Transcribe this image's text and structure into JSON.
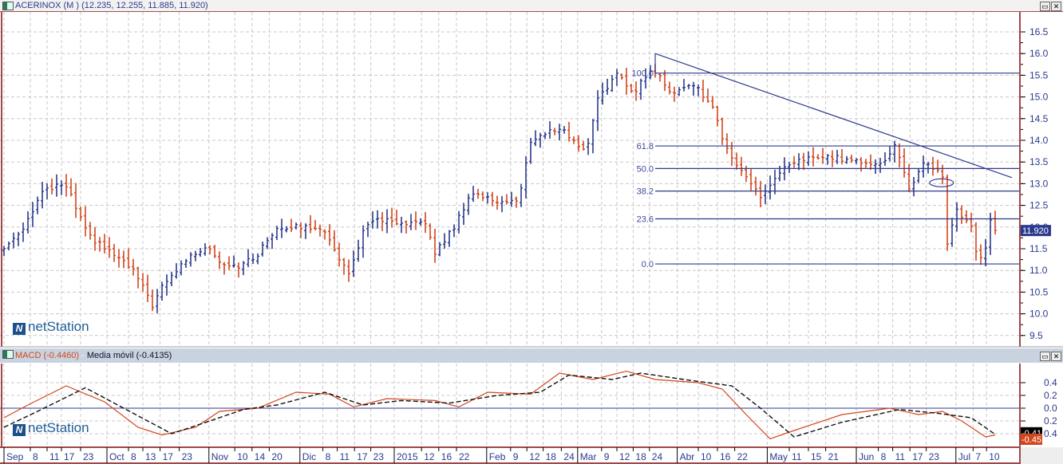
{
  "window": {
    "title": "ACERINOX (M ) (12.235, 12.255, 11.885, 11.920)",
    "macd_label": "MACD (-0.4460)",
    "macd_sep": " - ",
    "signal_label": "Media móvil (-0.4135)",
    "logo_text": "netStation",
    "restore_icon": "restore-icon",
    "close_icon": "close-icon",
    "restore_glyph": "▭",
    "close_glyph": "✕"
  },
  "colors": {
    "up": "#2b3a8c",
    "down": "#d2461e",
    "frame": "#a04848",
    "fib": "#2b3a8c",
    "last_bg": "#2b3a8c"
  },
  "chart_data": [
    {
      "type": "ohlc",
      "title": "ACERINOX (M )",
      "ylim": [
        9.5,
        16.5
      ],
      "y_ticks": [
        "9.5",
        "10.0",
        "10.5",
        "11.0",
        "11.5",
        "12.0",
        "12.5",
        "13.0",
        "13.5",
        "14.0",
        "14.5",
        "15.0",
        "15.5",
        "16.0",
        "16.5"
      ],
      "last_price": "11.920",
      "bar_count": 208,
      "close_keypoints": [
        [
          0,
          11.5
        ],
        [
          4,
          12.0
        ],
        [
          8,
          12.8
        ],
        [
          12.5,
          13.0
        ],
        [
          14,
          12.7
        ],
        [
          17.5,
          11.8
        ],
        [
          22.5,
          11.4
        ],
        [
          27,
          11.0
        ],
        [
          31,
          10.2
        ],
        [
          33,
          10.6
        ],
        [
          37.5,
          11.2
        ],
        [
          42.5,
          11.6
        ],
        [
          45,
          11.2
        ],
        [
          49,
          11.1
        ],
        [
          52.5,
          11.3
        ],
        [
          57,
          12.0
        ],
        [
          66,
          12.0
        ],
        [
          69,
          11.5
        ],
        [
          72,
          10.9
        ],
        [
          75,
          11.9
        ],
        [
          78,
          12.2
        ],
        [
          84,
          12.0
        ],
        [
          87.5,
          12.2
        ],
        [
          90,
          11.4
        ],
        [
          94,
          12.0
        ],
        [
          97.5,
          12.8
        ],
        [
          102.5,
          12.6
        ],
        [
          107.5,
          12.6
        ],
        [
          110,
          14.0
        ],
        [
          116,
          14.3
        ],
        [
          119,
          14.0
        ],
        [
          121.5,
          13.7
        ],
        [
          124,
          15.0
        ],
        [
          128,
          15.5
        ],
        [
          131.5,
          15.1
        ],
        [
          134,
          15.5
        ],
        [
          136,
          15.6
        ],
        [
          139,
          15.1
        ],
        [
          144,
          15.3
        ],
        [
          148,
          14.8
        ],
        [
          150,
          14.0
        ],
        [
          154,
          13.3
        ],
        [
          158,
          12.7
        ],
        [
          162.5,
          13.3
        ],
        [
          167.5,
          13.6
        ],
        [
          174,
          13.6
        ],
        [
          179,
          13.5
        ],
        [
          184,
          13.5
        ],
        [
          186,
          13.9
        ],
        [
          189,
          12.9
        ],
        [
          192.5,
          13.5
        ],
        [
          196,
          13.2
        ],
        [
          197,
          11.6
        ],
        [
          199,
          12.4
        ],
        [
          202,
          12.0
        ],
        [
          203.5,
          11.2
        ],
        [
          205,
          11.5
        ],
        [
          206,
          12.2
        ],
        [
          207,
          11.92
        ]
      ],
      "fibonacci": {
        "start_bar": 136,
        "levels": [
          {
            "label": "100.0",
            "price": 15.55
          },
          {
            "label": "61.8",
            "price": 13.87
          },
          {
            "label": "50.0",
            "price": 13.35
          },
          {
            "label": "38.2",
            "price": 12.83
          },
          {
            "label": "23.6",
            "price": 12.19
          },
          {
            "label": "0.0",
            "price": 11.15
          }
        ]
      },
      "trendline": [
        [
          136,
          16.0
        ],
        [
          210.5,
          13.14
        ]
      ],
      "ellipse": {
        "bar": 195.8,
        "price": 13.02
      }
    },
    {
      "type": "line",
      "title": "MACD",
      "ylim": [
        -0.6,
        0.6
      ],
      "y_ticks": [
        {
          "v": 0.4,
          "t": "0.4"
        },
        {
          "v": 0.2,
          "t": "0.2"
        },
        {
          "v": 0.0,
          "t": "0.0"
        },
        {
          "v": -0.2,
          "t": "0.2"
        },
        {
          "v": -0.4,
          "t": "0.4"
        }
      ],
      "series": [
        {
          "name": "MACD",
          "last": "-0.45",
          "style": "solid",
          "points": [
            [
              0,
              -0.15
            ],
            [
              5,
              0.05
            ],
            [
              13,
              0.35
            ],
            [
              21,
              0.1
            ],
            [
              28,
              -0.3
            ],
            [
              33,
              -0.42
            ],
            [
              40,
              -0.3
            ],
            [
              45,
              -0.05
            ],
            [
              53,
              0.0
            ],
            [
              61,
              0.25
            ],
            [
              68,
              0.22
            ],
            [
              73,
              0.02
            ],
            [
              80,
              0.15
            ],
            [
              90,
              0.12
            ],
            [
              95,
              0.02
            ],
            [
              101,
              0.25
            ],
            [
              110,
              0.22
            ],
            [
              116,
              0.55
            ],
            [
              123,
              0.45
            ],
            [
              130,
              0.58
            ],
            [
              136,
              0.45
            ],
            [
              145,
              0.4
            ],
            [
              150,
              0.3
            ],
            [
              155,
              -0.1
            ],
            [
              160,
              -0.48
            ],
            [
              165,
              -0.35
            ],
            [
              175,
              -0.1
            ],
            [
              185,
              0.0
            ],
            [
              191,
              -0.1
            ],
            [
              196,
              -0.05
            ],
            [
              200,
              -0.2
            ],
            [
              205,
              -0.45
            ],
            [
              207,
              -0.42
            ]
          ]
        },
        {
          "name": "Media móvil",
          "last": "-0.41",
          "style": "dashed",
          "points": [
            [
              0,
              -0.3
            ],
            [
              7,
              -0.05
            ],
            [
              17,
              0.32
            ],
            [
              25,
              0.0
            ],
            [
              35,
              -0.4
            ],
            [
              43,
              -0.2
            ],
            [
              50,
              -0.02
            ],
            [
              57,
              0.05
            ],
            [
              67,
              0.25
            ],
            [
              75,
              0.05
            ],
            [
              83,
              0.12
            ],
            [
              93,
              0.08
            ],
            [
              103,
              0.2
            ],
            [
              112,
              0.25
            ],
            [
              118,
              0.52
            ],
            [
              127,
              0.45
            ],
            [
              133,
              0.55
            ],
            [
              142,
              0.45
            ],
            [
              152,
              0.35
            ],
            [
              158,
              0.0
            ],
            [
              165,
              -0.45
            ],
            [
              175,
              -0.22
            ],
            [
              187,
              -0.02
            ],
            [
              195,
              -0.08
            ],
            [
              202,
              -0.15
            ],
            [
              207,
              -0.41
            ]
          ]
        }
      ]
    }
  ],
  "x_axis": {
    "labels": [
      {
        "t": "Sep",
        "bar": 0,
        "month": true
      },
      {
        "t": "8",
        "bar": 5.5
      },
      {
        "t": "11",
        "bar": 9
      },
      {
        "t": "17",
        "bar": 12
      },
      {
        "t": "23",
        "bar": 16
      },
      {
        "t": "Oct",
        "bar": 21.5,
        "month": true
      },
      {
        "t": "8",
        "bar": 26
      },
      {
        "t": "13",
        "bar": 29
      },
      {
        "t": "17",
        "bar": 32.6
      },
      {
        "t": "23",
        "bar": 36.6
      },
      {
        "t": "Nov",
        "bar": 42.8,
        "month": true
      },
      {
        "t": "10",
        "bar": 48.2
      },
      {
        "t": "14",
        "bar": 51.8
      },
      {
        "t": "20",
        "bar": 55.4
      },
      {
        "t": "Dic",
        "bar": 61.8,
        "month": true
      },
      {
        "t": "8",
        "bar": 66.6
      },
      {
        "t": "11",
        "bar": 69.6
      },
      {
        "t": "17",
        "bar": 73.2
      },
      {
        "t": "23",
        "bar": 76.6
      },
      {
        "t": "2015",
        "bar": 81.5,
        "month": true
      },
      {
        "t": "12",
        "bar": 87.2
      },
      {
        "t": "16",
        "bar": 90.8
      },
      {
        "t": "22",
        "bar": 94.5
      },
      {
        "t": "Feb",
        "bar": 100.8,
        "month": true
      },
      {
        "t": "9",
        "bar": 105.8
      },
      {
        "t": "12",
        "bar": 109.2
      },
      {
        "t": "18",
        "bar": 112.6
      },
      {
        "t": "24",
        "bar": 116.4
      },
      {
        "t": "Mar",
        "bar": 119.8,
        "month": true
      },
      {
        "t": "9",
        "bar": 124.8
      },
      {
        "t": "12",
        "bar": 128
      },
      {
        "t": "18",
        "bar": 131.4
      },
      {
        "t": "24",
        "bar": 134.8
      },
      {
        "t": "Abr",
        "bar": 140.6,
        "month": true
      },
      {
        "t": "10",
        "bar": 145
      },
      {
        "t": "16",
        "bar": 149
      },
      {
        "t": "22",
        "bar": 152.6
      },
      {
        "t": "May",
        "bar": 159.4,
        "month": true
      },
      {
        "t": "11",
        "bar": 164
      },
      {
        "t": "15",
        "bar": 168
      },
      {
        "t": "21",
        "bar": 171.6
      },
      {
        "t": "Jun",
        "bar": 178,
        "month": true
      },
      {
        "t": "8",
        "bar": 182.6
      },
      {
        "t": "11",
        "bar": 185.6
      },
      {
        "t": "17",
        "bar": 189.2
      },
      {
        "t": "23",
        "bar": 192.6
      },
      {
        "t": "Jul",
        "bar": 198.8,
        "month": true
      },
      {
        "t": "7",
        "bar": 202.4
      },
      {
        "t": "10",
        "bar": 205.2
      }
    ]
  }
}
